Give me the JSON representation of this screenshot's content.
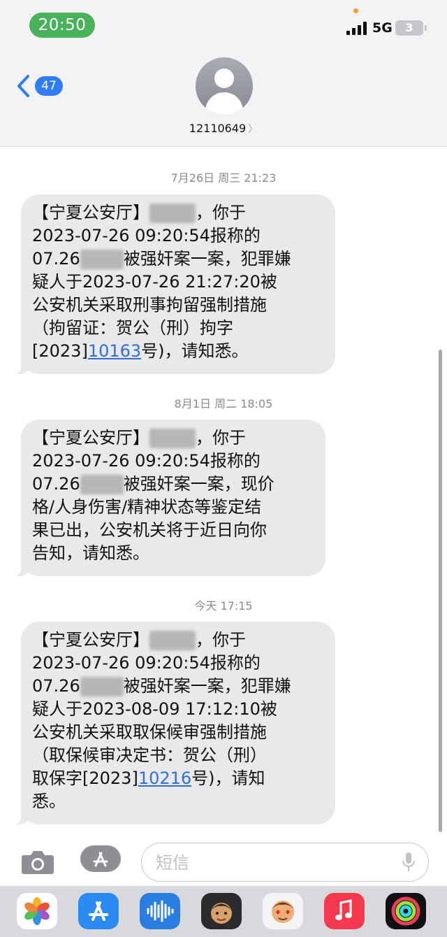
{
  "status_bar": {
    "time": "20:50",
    "network": "5G",
    "battery": "3",
    "colors": {
      "time_pill": "#47b25a",
      "indicator_dot": "#f39a2b"
    }
  },
  "header": {
    "back_badge": "47",
    "contact_number": "12110649",
    "icons": [
      "chevron-left-icon",
      "person-avatar-icon",
      "chevron-right-icon"
    ]
  },
  "messages": [
    {
      "timestamp": "7月26日 周三 21:23",
      "lines": [
        [
          "【宁夏公安厅】",
          "，你于"
        ],
        [
          "2023-07-26 09:20:54报称的"
        ],
        [
          "07.26",
          "被强奸案一案，犯罪嫌"
        ],
        [
          "疑人于2023-07-26 21:27:20被"
        ],
        [
          "公安机关采取刑事拘留强制措施"
        ],
        [
          "（拘留证：贺公（刑）拘字"
        ],
        [
          "[2023]",
          "10163",
          "号)，请知悉。"
        ]
      ]
    },
    {
      "timestamp": "8月1日 周二 18:05",
      "lines": [
        [
          "【宁夏公安厅】",
          "，你于"
        ],
        [
          "2023-07-26 09:20:54报称的"
        ],
        [
          "07.26",
          "被强奸案一案，现价"
        ],
        [
          "格/人身伤害/精神状态等鉴定结"
        ],
        [
          "果已出，公安机关将于近日向你"
        ],
        [
          "告知，请知悉。"
        ]
      ]
    },
    {
      "timestamp": "今天 17:15",
      "lines": [
        [
          "【宁夏公安厅】",
          "，你于"
        ],
        [
          "2023-07-26 09:20:54报称的"
        ],
        [
          "07.26",
          "被强奸案一案，犯罪嫌"
        ],
        [
          "疑人于2023-08-09 17:12:10被"
        ],
        [
          "公安机关采取取保候审强制措施"
        ],
        [
          "（取保候审决定书：贺公（刑）"
        ],
        [
          "取保字[2023]",
          "10216",
          "号)，请知"
        ],
        [
          "悉。"
        ]
      ]
    }
  ],
  "colors": {
    "bubble": "#e9e9eb",
    "link": "#2f6fd8",
    "badge": "#2f7cf6"
  },
  "composer": {
    "placeholder": "短信",
    "icons": [
      "camera-icon",
      "app-store-icon",
      "microphone-icon"
    ]
  },
  "dock_apps": [
    "photos-app-icon",
    "app-store-app-icon",
    "audio-messages-app-icon",
    "memoji-app-icon",
    "memoji-stickers-app-icon",
    "music-app-icon",
    "fitness-app-icon"
  ]
}
